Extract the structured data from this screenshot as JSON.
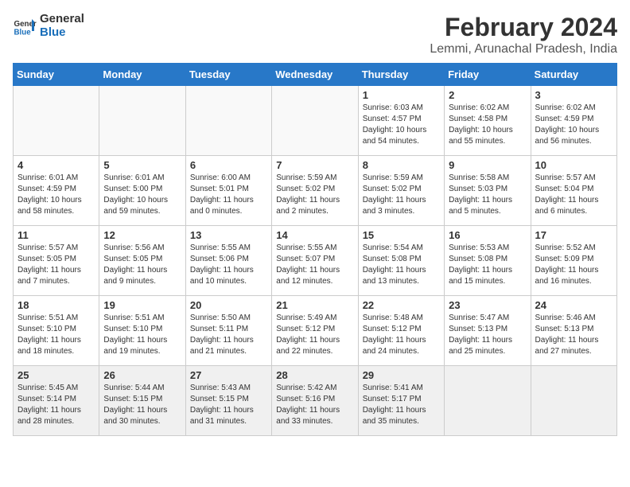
{
  "logo": {
    "line1": "General",
    "line2": "Blue"
  },
  "title": "February 2024",
  "subtitle": "Lemmi, Arunachal Pradesh, India",
  "headers": [
    "Sunday",
    "Monday",
    "Tuesday",
    "Wednesday",
    "Thursday",
    "Friday",
    "Saturday"
  ],
  "weeks": [
    [
      {
        "day": "",
        "info": ""
      },
      {
        "day": "",
        "info": ""
      },
      {
        "day": "",
        "info": ""
      },
      {
        "day": "",
        "info": ""
      },
      {
        "day": "1",
        "info": "Sunrise: 6:03 AM\nSunset: 4:57 PM\nDaylight: 10 hours\nand 54 minutes."
      },
      {
        "day": "2",
        "info": "Sunrise: 6:02 AM\nSunset: 4:58 PM\nDaylight: 10 hours\nand 55 minutes."
      },
      {
        "day": "3",
        "info": "Sunrise: 6:02 AM\nSunset: 4:59 PM\nDaylight: 10 hours\nand 56 minutes."
      }
    ],
    [
      {
        "day": "4",
        "info": "Sunrise: 6:01 AM\nSunset: 4:59 PM\nDaylight: 10 hours\nand 58 minutes."
      },
      {
        "day": "5",
        "info": "Sunrise: 6:01 AM\nSunset: 5:00 PM\nDaylight: 10 hours\nand 59 minutes."
      },
      {
        "day": "6",
        "info": "Sunrise: 6:00 AM\nSunset: 5:01 PM\nDaylight: 11 hours\nand 0 minutes."
      },
      {
        "day": "7",
        "info": "Sunrise: 5:59 AM\nSunset: 5:02 PM\nDaylight: 11 hours\nand 2 minutes."
      },
      {
        "day": "8",
        "info": "Sunrise: 5:59 AM\nSunset: 5:02 PM\nDaylight: 11 hours\nand 3 minutes."
      },
      {
        "day": "9",
        "info": "Sunrise: 5:58 AM\nSunset: 5:03 PM\nDaylight: 11 hours\nand 5 minutes."
      },
      {
        "day": "10",
        "info": "Sunrise: 5:57 AM\nSunset: 5:04 PM\nDaylight: 11 hours\nand 6 minutes."
      }
    ],
    [
      {
        "day": "11",
        "info": "Sunrise: 5:57 AM\nSunset: 5:05 PM\nDaylight: 11 hours\nand 7 minutes."
      },
      {
        "day": "12",
        "info": "Sunrise: 5:56 AM\nSunset: 5:05 PM\nDaylight: 11 hours\nand 9 minutes."
      },
      {
        "day": "13",
        "info": "Sunrise: 5:55 AM\nSunset: 5:06 PM\nDaylight: 11 hours\nand 10 minutes."
      },
      {
        "day": "14",
        "info": "Sunrise: 5:55 AM\nSunset: 5:07 PM\nDaylight: 11 hours\nand 12 minutes."
      },
      {
        "day": "15",
        "info": "Sunrise: 5:54 AM\nSunset: 5:08 PM\nDaylight: 11 hours\nand 13 minutes."
      },
      {
        "day": "16",
        "info": "Sunrise: 5:53 AM\nSunset: 5:08 PM\nDaylight: 11 hours\nand 15 minutes."
      },
      {
        "day": "17",
        "info": "Sunrise: 5:52 AM\nSunset: 5:09 PM\nDaylight: 11 hours\nand 16 minutes."
      }
    ],
    [
      {
        "day": "18",
        "info": "Sunrise: 5:51 AM\nSunset: 5:10 PM\nDaylight: 11 hours\nand 18 minutes."
      },
      {
        "day": "19",
        "info": "Sunrise: 5:51 AM\nSunset: 5:10 PM\nDaylight: 11 hours\nand 19 minutes."
      },
      {
        "day": "20",
        "info": "Sunrise: 5:50 AM\nSunset: 5:11 PM\nDaylight: 11 hours\nand 21 minutes."
      },
      {
        "day": "21",
        "info": "Sunrise: 5:49 AM\nSunset: 5:12 PM\nDaylight: 11 hours\nand 22 minutes."
      },
      {
        "day": "22",
        "info": "Sunrise: 5:48 AM\nSunset: 5:12 PM\nDaylight: 11 hours\nand 24 minutes."
      },
      {
        "day": "23",
        "info": "Sunrise: 5:47 AM\nSunset: 5:13 PM\nDaylight: 11 hours\nand 25 minutes."
      },
      {
        "day": "24",
        "info": "Sunrise: 5:46 AM\nSunset: 5:13 PM\nDaylight: 11 hours\nand 27 minutes."
      }
    ],
    [
      {
        "day": "25",
        "info": "Sunrise: 5:45 AM\nSunset: 5:14 PM\nDaylight: 11 hours\nand 28 minutes."
      },
      {
        "day": "26",
        "info": "Sunrise: 5:44 AM\nSunset: 5:15 PM\nDaylight: 11 hours\nand 30 minutes."
      },
      {
        "day": "27",
        "info": "Sunrise: 5:43 AM\nSunset: 5:15 PM\nDaylight: 11 hours\nand 31 minutes."
      },
      {
        "day": "28",
        "info": "Sunrise: 5:42 AM\nSunset: 5:16 PM\nDaylight: 11 hours\nand 33 minutes."
      },
      {
        "day": "29",
        "info": "Sunrise: 5:41 AM\nSunset: 5:17 PM\nDaylight: 11 hours\nand 35 minutes."
      },
      {
        "day": "",
        "info": ""
      },
      {
        "day": "",
        "info": ""
      }
    ]
  ]
}
